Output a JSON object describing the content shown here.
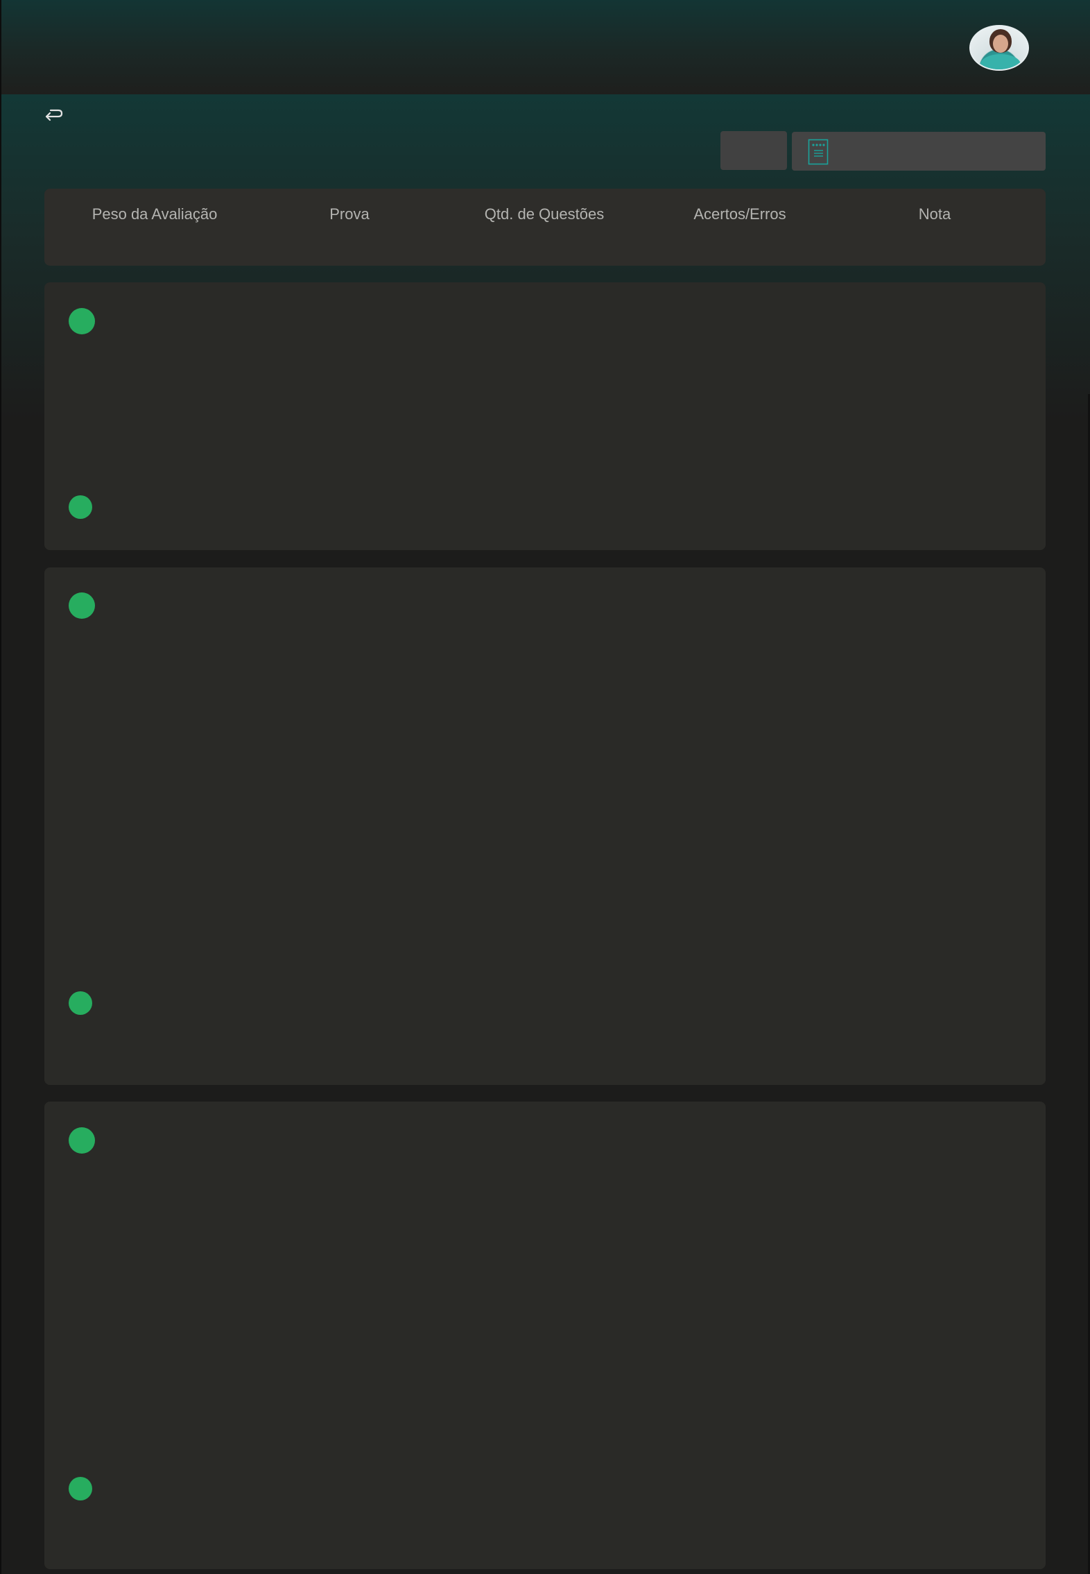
{
  "header": {
    "avatar_icon": "user-avatar-photo"
  },
  "toolbar": {
    "back_icon": "return-arrow-icon",
    "document_icon": "document-icon"
  },
  "table_header": {
    "columns": [
      {
        "label": "Peso da Avaliação"
      },
      {
        "label": "Prova"
      },
      {
        "label": "Qtd. de Questões"
      },
      {
        "label": "Acertos/Erros"
      },
      {
        "label": "Nota"
      }
    ]
  },
  "cards": [
    {
      "status_color": "#27ad5f"
    },
    {
      "status_color": "#27ad5f"
    },
    {
      "status_color": "#27ad5f"
    }
  ],
  "colors": {
    "accent_green": "#27ad5f",
    "accent_teal": "#1aa39b",
    "background": "#1c1c1b",
    "card": "#2a2a27"
  }
}
